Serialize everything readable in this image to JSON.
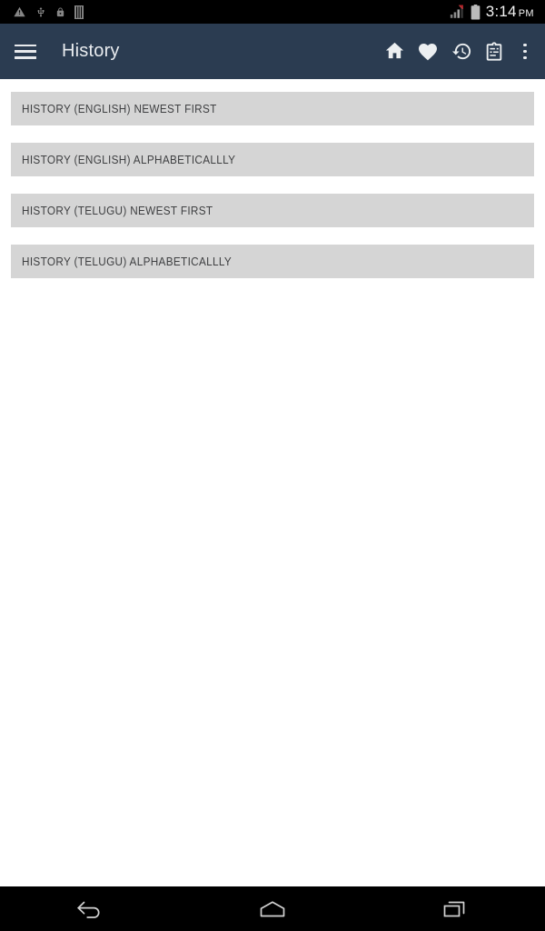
{
  "status_bar": {
    "left_icons": [
      {
        "name": "warning-triangle-icon",
        "glyph": "warning"
      },
      {
        "name": "usb-icon",
        "glyph": "usb"
      },
      {
        "name": "lock-icon",
        "glyph": "lock"
      },
      {
        "name": "sd-card-icon",
        "glyph": "bars"
      }
    ],
    "right_icons": [
      {
        "name": "signal-no-service-icon",
        "glyph": "signal"
      },
      {
        "name": "battery-icon",
        "glyph": "battery"
      }
    ],
    "time": "3:14",
    "ampm": "PM",
    "background_color": "#000000",
    "text_color": "#f2f2f2"
  },
  "app_bar": {
    "drawer_icon": "hamburger-menu-icon",
    "title": "History",
    "background_color": "#2b3c51",
    "icon_color": "#eceff1",
    "actions": [
      {
        "name": "home-action",
        "icon": "home-icon",
        "label": "Home"
      },
      {
        "name": "favorites-action",
        "icon": "heart-icon",
        "label": "Favorites"
      },
      {
        "name": "history-action",
        "icon": "history-clock-icon",
        "label": "History"
      },
      {
        "name": "notes-action",
        "icon": "clipboard-icon",
        "label": "Notes"
      },
      {
        "name": "overflow-action",
        "icon": "more-vert-icon",
        "label": "More options"
      }
    ]
  },
  "main": {
    "background_color": "#ffffff",
    "list_item_background": "#d5d5d5",
    "list_item_text_color": "#3f4042",
    "items": [
      {
        "label": "HISTORY (ENGLISH) NEWEST FIRST"
      },
      {
        "label": "HISTORY (ENGLISH) ALPHABETICALLLY"
      },
      {
        "label": "HISTORY (TELUGU) NEWEST FIRST"
      },
      {
        "label": "HISTORY (TELUGU) ALPHABETICALLLY"
      }
    ]
  },
  "nav_bar": {
    "background_color": "#000000",
    "buttons": [
      {
        "name": "nav-back-button",
        "icon": "back-arrow-icon",
        "label": "Back"
      },
      {
        "name": "nav-home-button",
        "icon": "home-outline-icon",
        "label": "Home"
      },
      {
        "name": "nav-recents-button",
        "icon": "recents-icon",
        "label": "Recents"
      }
    ]
  }
}
